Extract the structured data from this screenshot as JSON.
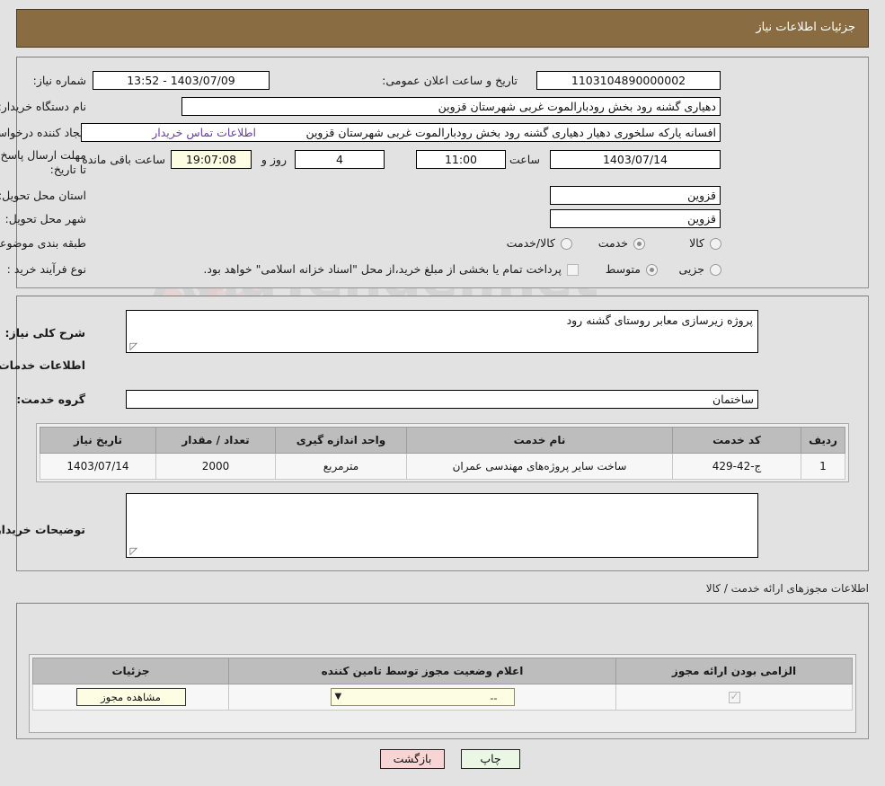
{
  "header": {
    "title": "جزئیات اطلاعات نیاز"
  },
  "top_form": {
    "need_number_label": "شماره نیاز:",
    "need_number_value": "1103104890000002",
    "announce_datetime_label": "تاریخ و ساعت اعلان عمومی:",
    "announce_datetime_value": "1403/07/09 - 13:52",
    "buyer_org_label": "نام دستگاه خریدار:",
    "buyer_org_value": "دهیاری گشنه رود بخش رودبارالموت غربی شهرستان قزوین",
    "requester_label": "ایجاد کننده درخواست:",
    "requester_value": "افسانه یارکه سلخوری دهیار دهیاری گشنه رود بخش رودبارالموت غربی شهرستان قزوین",
    "buyer_contact_link": "اطلاعات تماس خریدار",
    "deadline_label": "مهلت ارسال پاسخ: تا تاریخ:",
    "deadline_date": "1403/07/14",
    "deadline_hour_label": "ساعت",
    "deadline_hour": "11:00",
    "remaining_days": "4",
    "remaining_days_label": "روز و",
    "remaining_time": "19:07:08",
    "remaining_time_label": "ساعت باقی مانده",
    "province_label": "استان محل تحویل:",
    "province_value": "قزوین",
    "city_label": "شهر محل تحویل:",
    "city_value": "قزوین",
    "category_label": "طبقه بندی موضوعی:",
    "category_options": [
      "کالا",
      "خدمت",
      "کالا/خدمت"
    ],
    "category_selected": "خدمت",
    "process_type_label": "نوع فرآیند خرید :",
    "process_options": [
      "جزیی",
      "متوسط"
    ],
    "process_selected": "متوسط",
    "treasury_note": "پرداخت تمام یا بخشی از مبلغ خرید،از محل \"اسناد خزانه اسلامی\" خواهد بود."
  },
  "mid_form": {
    "summary_label": "شرح کلی نیاز:",
    "summary_value": "پروژه زیرسازی معابر روستای گشنه رود",
    "services_section_title": "اطلاعات خدمات مورد نیاز",
    "service_group_label": "گروه خدمت:",
    "service_group_value": "ساختمان",
    "buyer_notes_label": "توضیحات خریدار:",
    "buyer_notes_value": ""
  },
  "services_table": {
    "columns": [
      "ردیف",
      "کد خدمت",
      "نام خدمت",
      "واحد اندازه گیری",
      "تعداد / مقدار",
      "تاریخ نیاز"
    ],
    "rows": [
      {
        "row": "1",
        "code": "ج-42-429",
        "name": "ساخت سایر پروژه‌های مهندسی عمران",
        "unit": "مترمربع",
        "quantity": "2000",
        "need_date": "1403/07/14"
      }
    ]
  },
  "licenses": {
    "section_title": "اطلاعات مجوزهای ارائه خدمت / کالا",
    "columns": [
      "الزامی بودن ارائه مجوز",
      "اعلام وضعیت مجوز توسط تامین کننده",
      "جزئیات"
    ],
    "rows": [
      {
        "required": true,
        "status_value": "--",
        "details_button": "مشاهده مجوز"
      }
    ]
  },
  "footer": {
    "back_button": "بازگشت",
    "print_button": "چاپ"
  },
  "watermark": {
    "text": "AriaTender.net"
  },
  "colors": {
    "header_bg": "#8a6c42",
    "page_bg": "#e2e2e2",
    "link": "#6a3fa0",
    "back_btn": "#f9d4d4",
    "print_btn": "#e9f7e4",
    "table_header": "#bdbdbd"
  }
}
